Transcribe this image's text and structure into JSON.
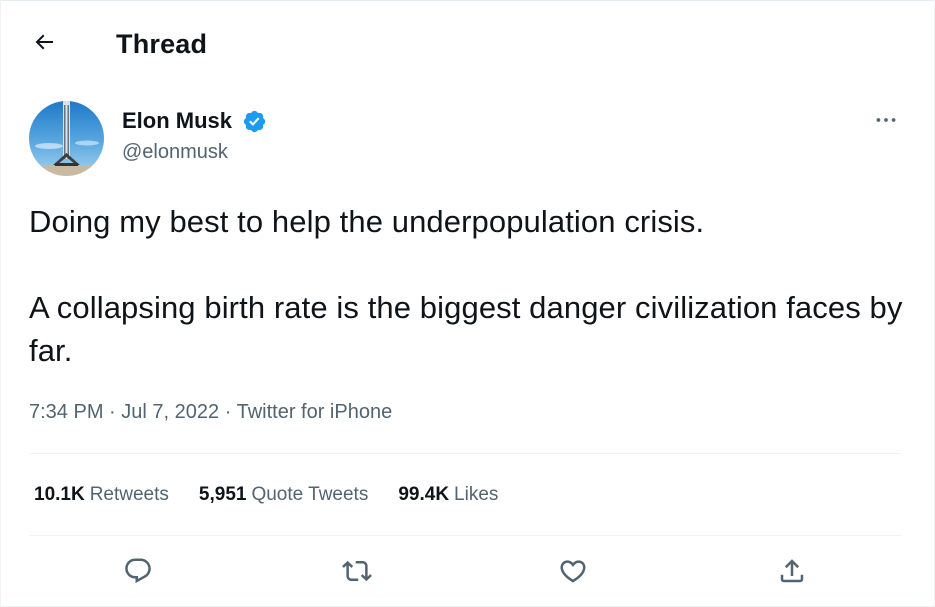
{
  "header": {
    "title": "Thread",
    "back_icon": "arrow-left-icon"
  },
  "author": {
    "display_name": "Elon Musk",
    "handle": "@elonmusk",
    "verified": true,
    "verified_color": "#1d9bf0"
  },
  "tweet": {
    "paragraphs": [
      "Doing my best to help the underpopulation crisis.",
      "A collapsing birth rate is the biggest danger civilization faces by far."
    ],
    "time": "7:34 PM",
    "separator": "·",
    "date": "Jul 7, 2022",
    "source": "Twitter for iPhone"
  },
  "stats": {
    "retweets": {
      "count": "10.1K",
      "label": "Retweets"
    },
    "quote_tweets": {
      "count": "5,951",
      "label": "Quote Tweets"
    },
    "likes": {
      "count": "99.4K",
      "label": "Likes"
    }
  },
  "actions": [
    {
      "name": "reply",
      "icon": "comment-icon"
    },
    {
      "name": "retweet",
      "icon": "retweet-icon"
    },
    {
      "name": "like",
      "icon": "heart-icon"
    },
    {
      "name": "share",
      "icon": "share-icon"
    }
  ],
  "colors": {
    "text_primary": "#0f1419",
    "text_secondary": "#536471",
    "accent": "#1d9bf0",
    "divider": "#eff3f4"
  }
}
